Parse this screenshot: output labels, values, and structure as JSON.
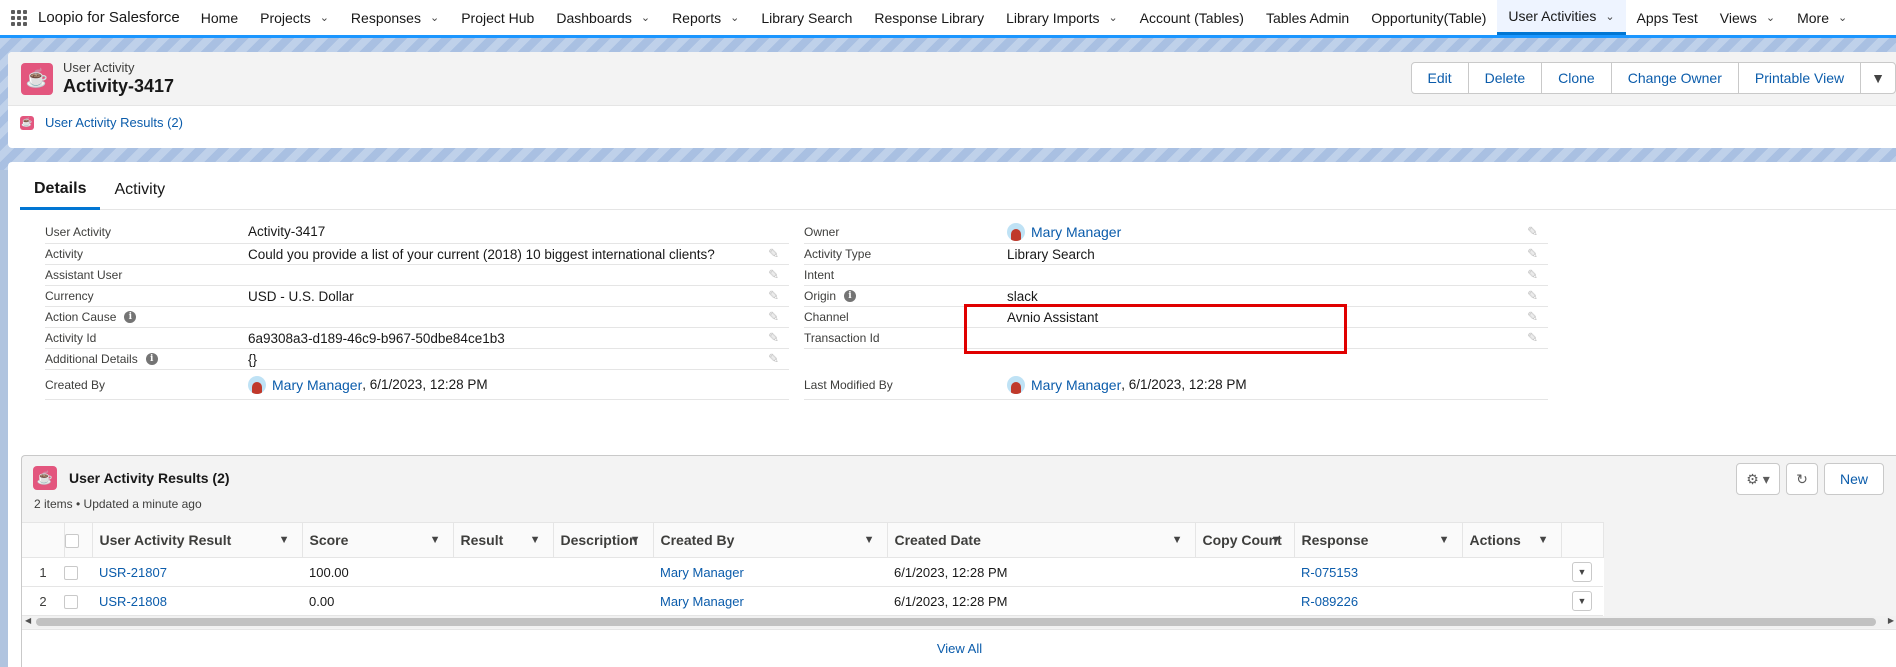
{
  "app": {
    "name": "Loopio for Salesforce"
  },
  "nav": [
    {
      "label": "Home",
      "dropdown": false,
      "active": false
    },
    {
      "label": "Projects",
      "dropdown": true,
      "active": false
    },
    {
      "label": "Responses",
      "dropdown": true,
      "active": false
    },
    {
      "label": "Project Hub",
      "dropdown": false,
      "active": false
    },
    {
      "label": "Dashboards",
      "dropdown": true,
      "active": false
    },
    {
      "label": "Reports",
      "dropdown": true,
      "active": false
    },
    {
      "label": "Library Search",
      "dropdown": false,
      "active": false
    },
    {
      "label": "Response Library",
      "dropdown": false,
      "active": false
    },
    {
      "label": "Library Imports",
      "dropdown": true,
      "active": false
    },
    {
      "label": "Account (Tables)",
      "dropdown": false,
      "active": false
    },
    {
      "label": "Tables Admin",
      "dropdown": false,
      "active": false
    },
    {
      "label": "Opportunity(Table)",
      "dropdown": false,
      "active": false
    },
    {
      "label": "User Activities",
      "dropdown": true,
      "active": true
    },
    {
      "label": "Apps Test",
      "dropdown": false,
      "active": false
    },
    {
      "label": "Views",
      "dropdown": true,
      "active": false
    },
    {
      "label": "More",
      "dropdown": true,
      "active": false
    }
  ],
  "record": {
    "object_label": "User Activity",
    "title": "Activity-3417",
    "actions": [
      "Edit",
      "Delete",
      "Clone",
      "Change Owner",
      "Printable View"
    ],
    "related_link": "User Activity Results (2)"
  },
  "tabs": [
    "Details",
    "Activity"
  ],
  "fields_left": [
    {
      "label": "User Activity",
      "value": "Activity-3417",
      "info": false,
      "editable": false,
      "link": false
    },
    {
      "label": "Activity",
      "value": "Could you provide a list of your current (2018) 10 biggest international clients?",
      "info": false,
      "editable": true,
      "link": false
    },
    {
      "label": "Assistant User",
      "value": "",
      "info": false,
      "editable": true,
      "link": false
    },
    {
      "label": "Currency",
      "value": "USD - U.S. Dollar",
      "info": false,
      "editable": true,
      "link": false
    },
    {
      "label": "Action Cause",
      "value": "",
      "info": true,
      "editable": true,
      "link": false
    },
    {
      "label": "Activity Id",
      "value": "6a9308a3-d189-46c9-b967-50dbe84ce1b3",
      "info": false,
      "editable": true,
      "link": false
    },
    {
      "label": "Additional Details",
      "value": "{}",
      "info": true,
      "editable": true,
      "link": false
    },
    {
      "label": "Created By",
      "value": "Mary Manager",
      "suffix": ", 6/1/2023, 12:28 PM",
      "info": false,
      "editable": false,
      "link": true
    }
  ],
  "fields_right": [
    {
      "label": "Owner",
      "value": "Mary Manager",
      "info": false,
      "editable": true,
      "link": true
    },
    {
      "label": "Activity Type",
      "value": "Library Search",
      "info": false,
      "editable": true,
      "link": false
    },
    {
      "label": "Intent",
      "value": "",
      "info": false,
      "editable": true,
      "link": false
    },
    {
      "label": "Origin",
      "value": "slack",
      "info": true,
      "editable": true,
      "link": false
    },
    {
      "label": "Channel",
      "value": "Avnio Assistant",
      "info": false,
      "editable": true,
      "link": false
    },
    {
      "label": "Transaction Id",
      "value": "",
      "info": false,
      "editable": true,
      "link": false
    },
    {
      "label": "",
      "value": "",
      "info": false,
      "editable": false,
      "link": false
    },
    {
      "label": "Last Modified By",
      "value": "Mary Manager",
      "suffix": ", 6/1/2023, 12:28 PM",
      "info": false,
      "editable": false,
      "link": true
    }
  ],
  "related_list": {
    "title": "User Activity Results (2)",
    "subtitle": "2 items • Updated a minute ago",
    "new_label": "New",
    "columns": [
      "User Activity Result",
      "Score",
      "Result",
      "Description",
      "Created By",
      "Created Date",
      "Copy Count",
      "Response",
      "Actions"
    ],
    "rows": [
      {
        "num": "1",
        "name": "USR-21807",
        "score": "100.00",
        "result": "",
        "description": "",
        "created_by": "Mary Manager",
        "created_date": "6/1/2023, 12:28 PM",
        "copy_count": "",
        "response": "R-075153"
      },
      {
        "num": "2",
        "name": "USR-21808",
        "score": "0.00",
        "result": "",
        "description": "",
        "created_by": "Mary Manager",
        "created_date": "6/1/2023, 12:28 PM",
        "copy_count": "",
        "response": "R-089226"
      }
    ],
    "view_all": "View All"
  },
  "colors": {
    "brand": "#0176d3",
    "link": "#0b5cab",
    "object_icon": "#e3567e",
    "highlight": "#e00000"
  }
}
